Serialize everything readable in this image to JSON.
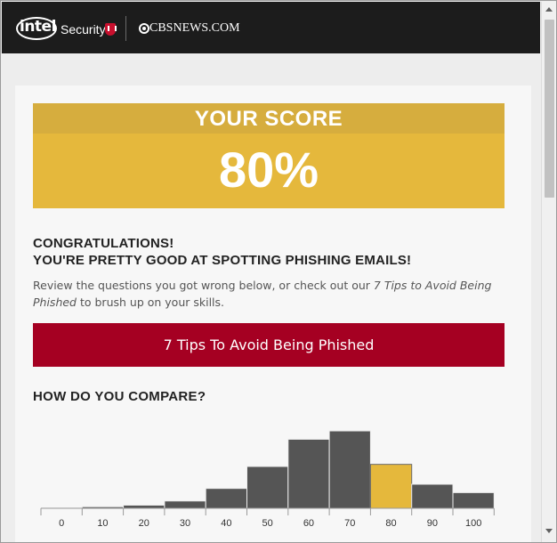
{
  "header": {
    "intel_brand": "intel",
    "security_label": "Security",
    "partner_brand": "CBSNEWS.COM"
  },
  "score": {
    "heading": "YOUR SCORE",
    "value": "80%"
  },
  "message": {
    "congrats_line1": "CONGRATULATIONS!",
    "congrats_line2": "YOU'RE PRETTY GOOD AT SPOTTING PHISHING EMAILS!",
    "review_prefix": "Review the questions you got wrong below, or check out our ",
    "review_link": "7 Tips to Avoid Being Phished",
    "review_suffix": " to brush up on your skills."
  },
  "cta": {
    "label": "7 Tips To Avoid Being Phished"
  },
  "compare": {
    "heading": "HOW DO YOU COMPARE?"
  },
  "colors": {
    "score_gold": "#e5b83c",
    "score_header_gold": "#d6ad3e",
    "cta_red": "#a50022",
    "bar_dark": "#555555",
    "bar_highlight": "#e5b83c"
  },
  "chart_data": {
    "type": "bar",
    "categories": [
      "0",
      "10",
      "20",
      "30",
      "40",
      "50",
      "60",
      "70",
      "80",
      "90",
      "100"
    ],
    "values": [
      0.5,
      1.5,
      3,
      7,
      19,
      40,
      66,
      74,
      42,
      23,
      15
    ],
    "highlight_category": "80",
    "xlabel": "",
    "ylabel": "",
    "ylim": [
      0,
      80
    ]
  }
}
